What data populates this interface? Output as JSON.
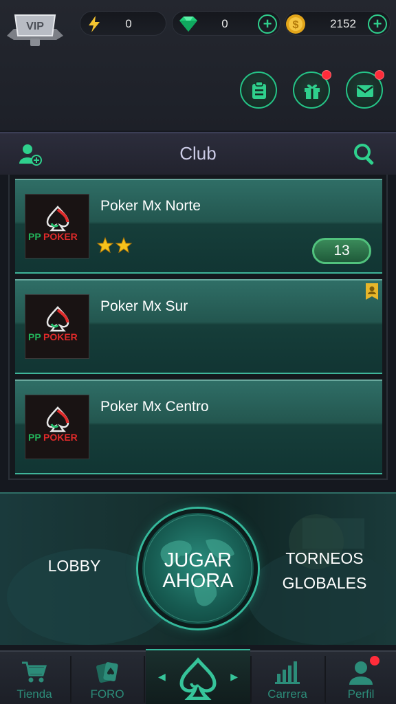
{
  "top_bar": {
    "vip_label": "VIP",
    "energy": {
      "icon": "lightning-icon",
      "value": "0"
    },
    "gems": {
      "icon": "gem-icon",
      "value": "0"
    },
    "coins": {
      "icon": "coin-icon",
      "value": "2152"
    },
    "actions": [
      "list-icon",
      "gift-icon",
      "mail-icon"
    ]
  },
  "club_header": {
    "title": "Club",
    "left_icon": "add-user-icon",
    "right_icon": "search-icon"
  },
  "clubs": [
    {
      "name": "Poker Mx Norte",
      "logo_text_a": "PP",
      "logo_text_b": "POKER",
      "stars": 2,
      "members": "13"
    },
    {
      "name": "Poker Mx Sur",
      "logo_text_a": "PP",
      "logo_text_b": "POKER",
      "owner_badge": true
    },
    {
      "name": "Poker Mx Centro",
      "logo_text_a": "PP",
      "logo_text_b": "POKER"
    }
  ],
  "play_section": {
    "lobby": "LOBBY",
    "play_line1": "JUGAR",
    "play_line2": "AHORA",
    "torneos_line1": "TORNEOS",
    "torneos_line2": "GLOBALES"
  },
  "bottom_nav": {
    "tienda": "Tienda",
    "foro": "FORO",
    "carrera": "Carrera",
    "perfil": "Perfil"
  },
  "colors": {
    "accent": "#2fd08d",
    "card": "#23564f",
    "badge_red": "#ff2c3a",
    "star": "#f6c21b"
  }
}
